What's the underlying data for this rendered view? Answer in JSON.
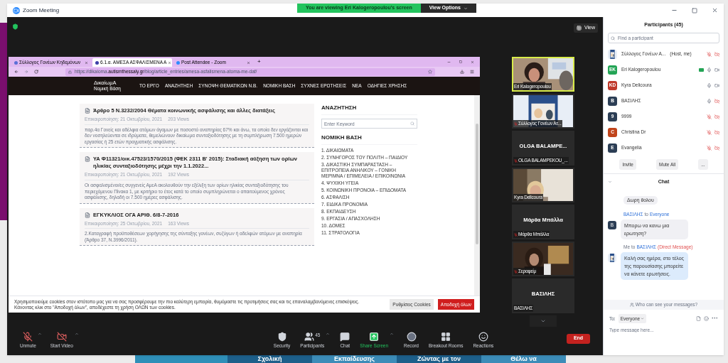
{
  "window": {
    "title": "Zoom Meeting"
  },
  "banner": {
    "text": "You are viewing Eri Kalogeropoulou's screen",
    "options": "View Options"
  },
  "view_button": "View",
  "browser": {
    "tabs": [
      {
        "label": "Σύλλογος Γονέων Κηδεμόνων",
        "selected": false,
        "color": "#5b6fd6"
      },
      {
        "label": "6.1.α. ΑΜΕΣΑ ΑΣΦΑΛΙΣΜΕΝΑ Α",
        "selected": true,
        "color": "#3b3fa8"
      },
      {
        "label": "Post Attendee - Zoom",
        "selected": false,
        "color": "#2d8cff"
      }
    ],
    "new_tab": "+",
    "url_prefix": "https://dikaioma.",
    "url_domain": "autismthessaly.gr",
    "url_path": "/blog/article_entries/amesa-asfalismena-atoma-me-daf/",
    "site": {
      "logo": "ΔικαίωμΑ",
      "logo_sub": "Νομική Βάση",
      "nav": [
        "ΤΟ ΕΡΓΟ",
        "ΑΝΑΖΗΤΗΣΗ",
        "ΣΥΝΟΨΗ ΘΕΜΑΤΙΚΩΝ Ν.Β.",
        "ΝΟΜΙΚΗ ΒΑΣΗ",
        "ΣΥΧΝΕΣ ΕΡΩΤΗΣΕΙΣ",
        "ΝΕΑ",
        "ΟΔΗΓΙΕΣ ΧΡΗΣΗΣ"
      ],
      "articles": [
        {
          "title": "Άρθρο 5 Ν.3232/2004 Θέματα κοινωνικής ασφάλισης και άλλες διατάξεις",
          "date": "Επικαιροποίηση: 21 Οκτωβρίου, 2021",
          "views": "203 Views",
          "excerpt": "παρ.4α Γονείς και αδέλφια ατόμων άγαμων με ποσοστό αναπηρίας 67% και άνω, τα οποία δεν εργάζονται και δεν νοσηλεύονται σε ιδρύματα, θεμελιώνουν δικαίωμα συνταξιοδότησης με τη συμπλήρωση 7.500 ημερών εργασίας ή 25 ετών πραγματικής ασφάλισης."
        },
        {
          "title": "ΥΑ Φ11321/οικ.47523/1570/2015 (ΦΕΚ 2311 Β' 2015): Σταδιακή αύξηση των ορίων ηλικίας συνταξιοδότησης μέχρι την 1.1.2022...",
          "date": "Επικαιροποίηση: 21 Οκτωβρίου, 2021",
          "views": "192 Views",
          "excerpt": "Οι ασφαλισμένοι/ες συγγενείς ΑμεΑ ακολουθούν την εξέλιξη των ορίων ηλικίας συνταξιοδότησης του περιεχόμενου Πίνακα 1, με κριτήριο το έτος κατά το οποίο συμπληρώνεται ο απαιτούμενος χρόνος ασφάλισης, δηλαδή οι 7.500 ημέρες ασφάλισης."
        },
        {
          "title": "ΕΓΚΥΚΛΙΟΣ ΟΓΑ ΑΡΙΘ. 6/8-7-2016",
          "date": "Επικαιροποίηση: 25 Οκτωβρίου, 2021",
          "views": "163 Views",
          "excerpt": "2.Καταγραφή προϋποθέσεων χορήγησης της σύνταξης γονέων, συζύγων ή αδελφών ατόμων με αναπηρία (Άρθρο 37, Ν.3996/2011)."
        }
      ],
      "sidebar": {
        "search_title": "ΑΝΑΖΗΤΗΣΗ",
        "search_placeholder": "Enter Keyword",
        "list_title": "ΝΟΜΙΚΗ ΒΑΣΗ",
        "items": [
          "1. ΔΙΚΑΙΩΜΑΤΑ",
          "2. ΣΥΝΗΓΟΡΟΣ ΤΟΥ ΠΟΛΙΤΗ – ΠΑΙΔΙΟΥ",
          "3. ΔΙΚΑΣΤΙΚΗ ΣΥΜΠΑΡΑΣΤΑΣΗ – ΕΠΙΤΡΟΠΕΙΑ ΑΝΗΛΙΚΟΥ – ΓΟΝΙΚΗ ΜΕΡΙΜΝΑ / ΕΠΙΜΕΛΕΙΑ / ΕΠΙΚΟΙΝΩΝΙΑ",
          "4. ΨΥΧΙΚΗ ΥΓΕΙΑ",
          "5. ΚΟΙΝΩΝΙΚΗ ΠΡΟΝΟΙΑ – ΕΠΙΔΟΜΑΤΑ",
          "6. ΑΣΦΑΛΙΣΗ",
          "7. ΕΙΔΙΚΑ ΠΡΟΝΟΜΙΑ",
          "8. ΕΚΠΑΙΔΕΥΣΗ",
          "9. ΕΡΓΑΣΙΑ / ΑΠΑΣΧΟΛΗΣΗ",
          "10. ΔΟΜΕΣ",
          "11. ΣΤΡΑΤΟΛΟΓΙΑ"
        ]
      },
      "cookie": {
        "text": "Χρησιμοποιούμε cookies στον ιστότοπο μας για να σας προσφέρουμε την πιο καλύτερη εμπειρία, θυμόμαστε τις προτιμήσεις σας και τις επαναλαμβανόμενες επισκέψεις. Κάνοντας κλικ στο \"Αποδοχή όλων\", αποδέχεστε τη χρήση ΟΛΩΝ των cookies.",
        "settings": "Ρυθμίσεις Cookies",
        "accept": "Αποδοχή όλων"
      }
    }
  },
  "video_tiles": [
    {
      "kind": "video",
      "name": "Eri Kalogeropoulou",
      "muted": false,
      "active": true
    },
    {
      "kind": "video",
      "name": "Σύλλογος Γονέων Ατ...",
      "muted": true,
      "active": false
    },
    {
      "kind": "name",
      "big_name": "OLGA BALAMPE...",
      "name": "OLGA BALAMPEKOU_...",
      "muted": true,
      "active": false
    },
    {
      "kind": "video",
      "name": "Kyra Delicoura",
      "muted": false,
      "active": false
    },
    {
      "kind": "name",
      "big_name": "Μάρθα Μπάλλα",
      "name": "Μάρθα Μπάλλα",
      "muted": true,
      "active": false
    },
    {
      "kind": "video",
      "name": "Σεραφείμ",
      "muted": true,
      "active": false
    },
    {
      "kind": "name",
      "big_name": "ΒΑΣΙΛΗΣ",
      "name": "ΒΑΣΙΛΗΣ",
      "muted": false,
      "active": false
    }
  ],
  "toolbar": {
    "left": [
      {
        "kind": "mic",
        "label": "Unmute",
        "off": true
      },
      {
        "kind": "video",
        "label": "Start Video",
        "off": true
      }
    ],
    "center": [
      {
        "kind": "security",
        "label": "Security"
      },
      {
        "kind": "participants",
        "label": "Participants",
        "count": "45"
      },
      {
        "kind": "chat",
        "label": "Chat"
      },
      {
        "kind": "share",
        "label": "Share Screen"
      },
      {
        "kind": "record",
        "label": "Record"
      },
      {
        "kind": "breakout",
        "label": "Breakout Rooms"
      },
      {
        "kind": "reactions",
        "label": "Reactions"
      }
    ],
    "end": "End"
  },
  "participants": {
    "title": "Participants (45)",
    "search_placeholder": "Find a participant",
    "list": [
      {
        "name": "Σύλλογος Γονέων Α...",
        "tag": "(Host, me)",
        "kind": "picture",
        "muted": true,
        "video_off": true,
        "sharing": false
      },
      {
        "name": "Eri Kalogeropoulou",
        "initials": "EK",
        "color": "#23a455",
        "kind": "initials",
        "muted": false,
        "video_off": false,
        "sharing": true
      },
      {
        "name": "Kyra Delicoura",
        "initials": "KD",
        "color": "#c0392b",
        "kind": "initials",
        "muted": false,
        "video_off": false,
        "sharing": false
      },
      {
        "name": "ΒΑΣΙΛΗΣ",
        "initials": "B",
        "color": "#2c3e55",
        "kind": "initials",
        "muted": false,
        "video_off": true,
        "sharing": false
      },
      {
        "name": "9999",
        "initials": "9",
        "color": "#2c3e55",
        "kind": "initials",
        "muted": true,
        "video_off": true,
        "sharing": false
      },
      {
        "name": "Christina Dr",
        "initials": "C",
        "color": "#c0441b",
        "kind": "initials",
        "muted": true,
        "video_off": true,
        "sharing": false
      },
      {
        "name": "Evangelia",
        "initials": "E",
        "color": "#2c3e55",
        "kind": "initials",
        "muted": true,
        "video_off": true,
        "sharing": false
      }
    ],
    "buttons": [
      "Invite",
      "Mute All",
      "..."
    ]
  },
  "chat": {
    "title": "Chat",
    "messages": [
      {
        "kind": "cut",
        "text": "Δωρη θολου"
      },
      {
        "kind": "incoming",
        "sender": "ΒΑΣΙΛΗΣ",
        "to_word": "to",
        "recipient": "Everyone",
        "initials": "B",
        "text": "Μπορω να κανω μια ερωτηση?"
      },
      {
        "kind": "outgoing",
        "sender": "Me",
        "to_word": "to",
        "recipient": "ΒΑΣΙΛΗΣ",
        "note": "(Direct Message)",
        "text": "Καλή σας ημέρα, στο τέλος της παρουσίασης μπορείτε να κάνετε ερωτήσεις."
      }
    ],
    "who": "Who can see your messages?",
    "to_label": "To:",
    "to_value": "Everyone",
    "more": "···",
    "placeholder": "Type message here..."
  },
  "desktop_tiles": [
    "Σχολική",
    "Εκπαίδευσης",
    "Ζώντας με τον",
    "Θέλω να"
  ]
}
